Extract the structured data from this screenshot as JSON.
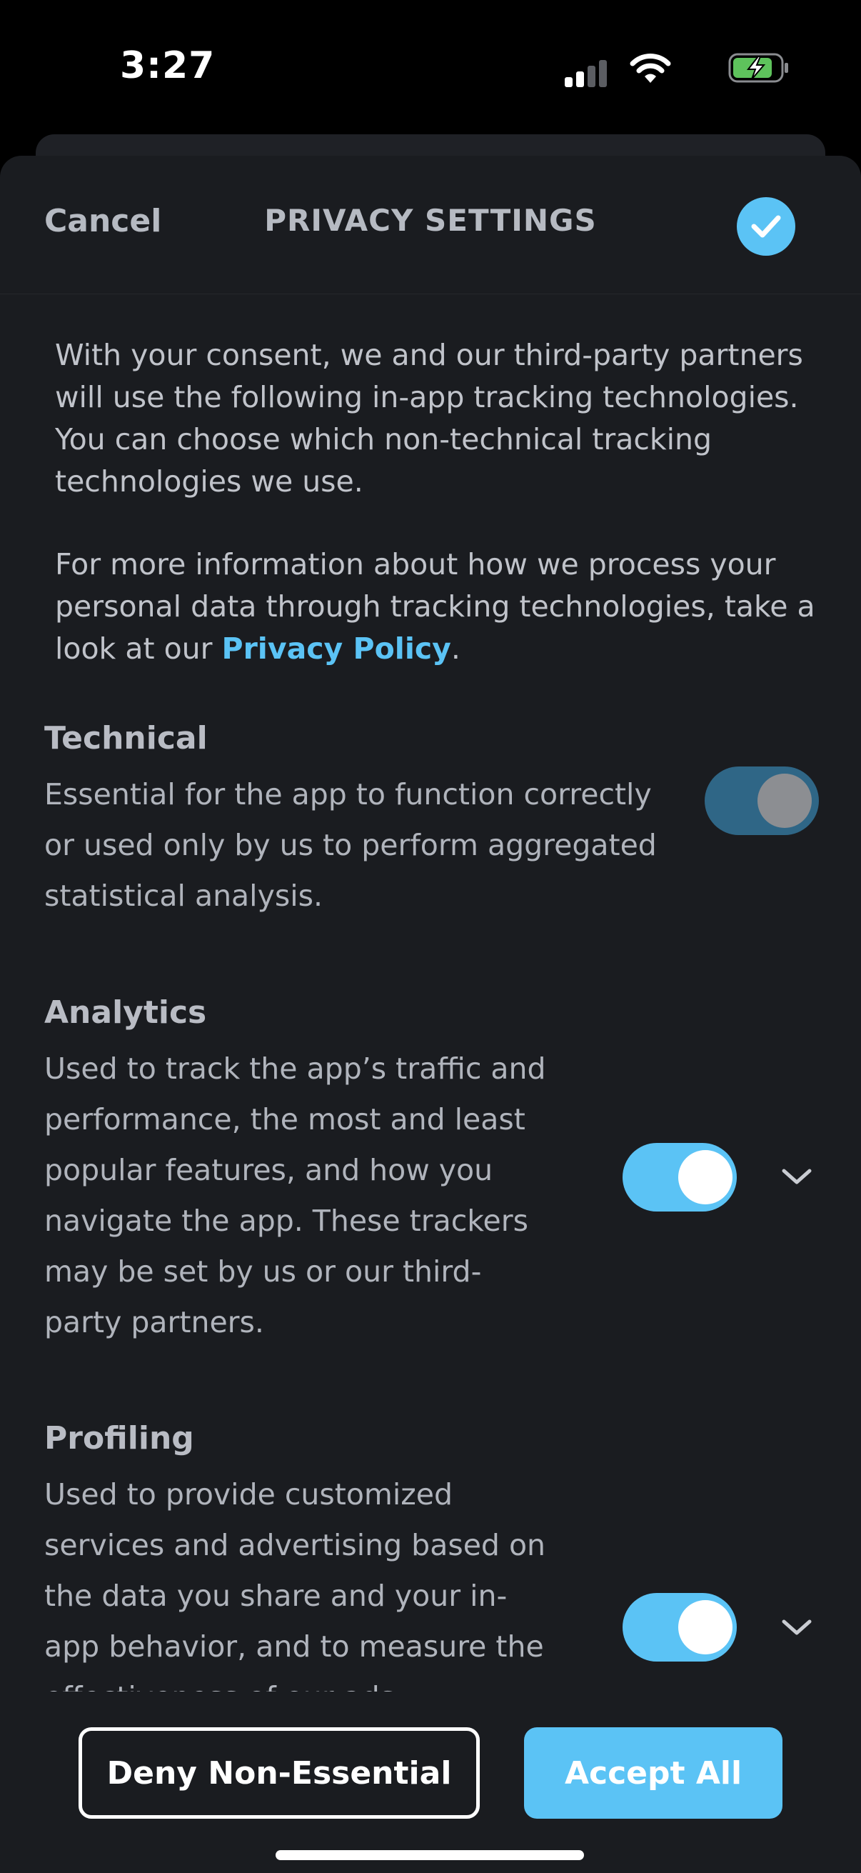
{
  "status_bar": {
    "time": "3:27",
    "icons": [
      "signal-icon",
      "wifi-icon",
      "battery-charging-icon"
    ]
  },
  "header": {
    "cancel_label": "Cancel",
    "title": "PRIVACY SETTINGS",
    "confirm_icon": "checkmark-icon"
  },
  "intro": {
    "paragraph1": "With your consent, we and our third-party partners will use the following in-app tracking technologies. You can choose which non-technical tracking technologies we use.",
    "paragraph2_prefix": "For more information about how we process your personal data through tracking technologies, take a look at our ",
    "privacy_link": "Privacy Policy",
    "paragraph2_suffix": "."
  },
  "sections": [
    {
      "title": "Technical",
      "description": "Essential for the app to function correctly or used only by us to perform aggregated statistical analysis.",
      "toggle_state": "on-disabled"
    },
    {
      "title": "Analytics",
      "description": "Used to track the app’s traffic and performance, the most and least popular features, and how you navigate the app. These trackers may be set by us or our third-party partners.",
      "toggle_state": "on"
    },
    {
      "title": "Profiling",
      "description": "Used to provide customized services and advertising based on the data you share and your in-app behavior, and to measure the effectiveness of our ads.",
      "toggle_state": "on"
    }
  ],
  "footer": {
    "deny_label": "Deny Non-Essential",
    "accept_label": "Accept All"
  },
  "colors": {
    "accent": "#5bc3f5",
    "background": "#1a1c20",
    "toggle_disabled_track": "#2f6686"
  }
}
